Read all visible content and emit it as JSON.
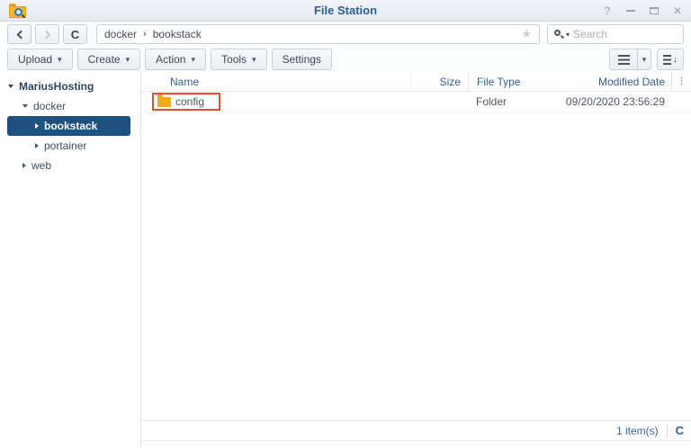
{
  "titlebar": {
    "title": "File Station"
  },
  "icons": {
    "help": "?",
    "close": "✕",
    "star": "★",
    "caret_down": "▾",
    "breadcrumb_sep": "›",
    "overflow_menu": "⋮",
    "refresh": "C",
    "sort_arrow": "↓"
  },
  "nav": {
    "breadcrumb": [
      "docker",
      "bookstack"
    ],
    "search": {
      "placeholder": "Search",
      "value": ""
    }
  },
  "toolbar": {
    "buttons": [
      {
        "label": "Upload",
        "has_menu": true
      },
      {
        "label": "Create",
        "has_menu": true
      },
      {
        "label": "Action",
        "has_menu": true
      },
      {
        "label": "Tools",
        "has_menu": true
      },
      {
        "label": "Settings",
        "has_menu": false
      }
    ]
  },
  "sidebar": {
    "items": [
      {
        "label": "MariusHosting",
        "level": 0,
        "state": "expanded",
        "selected": false
      },
      {
        "label": "docker",
        "level": 1,
        "state": "expanded",
        "selected": false
      },
      {
        "label": "bookstack",
        "level": 2,
        "state": "collapsed",
        "selected": true
      },
      {
        "label": "portainer",
        "level": 2,
        "state": "collapsed",
        "selected": false
      },
      {
        "label": "web",
        "level": 1,
        "state": "collapsed",
        "selected": false
      }
    ]
  },
  "table": {
    "headers": {
      "name": "Name",
      "size": "Size",
      "type": "File Type",
      "modified": "Modified Date"
    },
    "rows": [
      {
        "name": "config",
        "size": "",
        "type": "Folder",
        "modified": "09/20/2020 23:56:29",
        "icon": "folder-icon",
        "highlighted": true
      }
    ]
  },
  "status": {
    "count": "1 item(s)"
  },
  "colors": {
    "title_text": "#2d5f8f",
    "selected_item_bg": "#1e5180",
    "folder_icon": "#f7a823",
    "highlight_border": "#ee4a2a",
    "header_text": "#336193",
    "status_blue": "#3465a0"
  }
}
